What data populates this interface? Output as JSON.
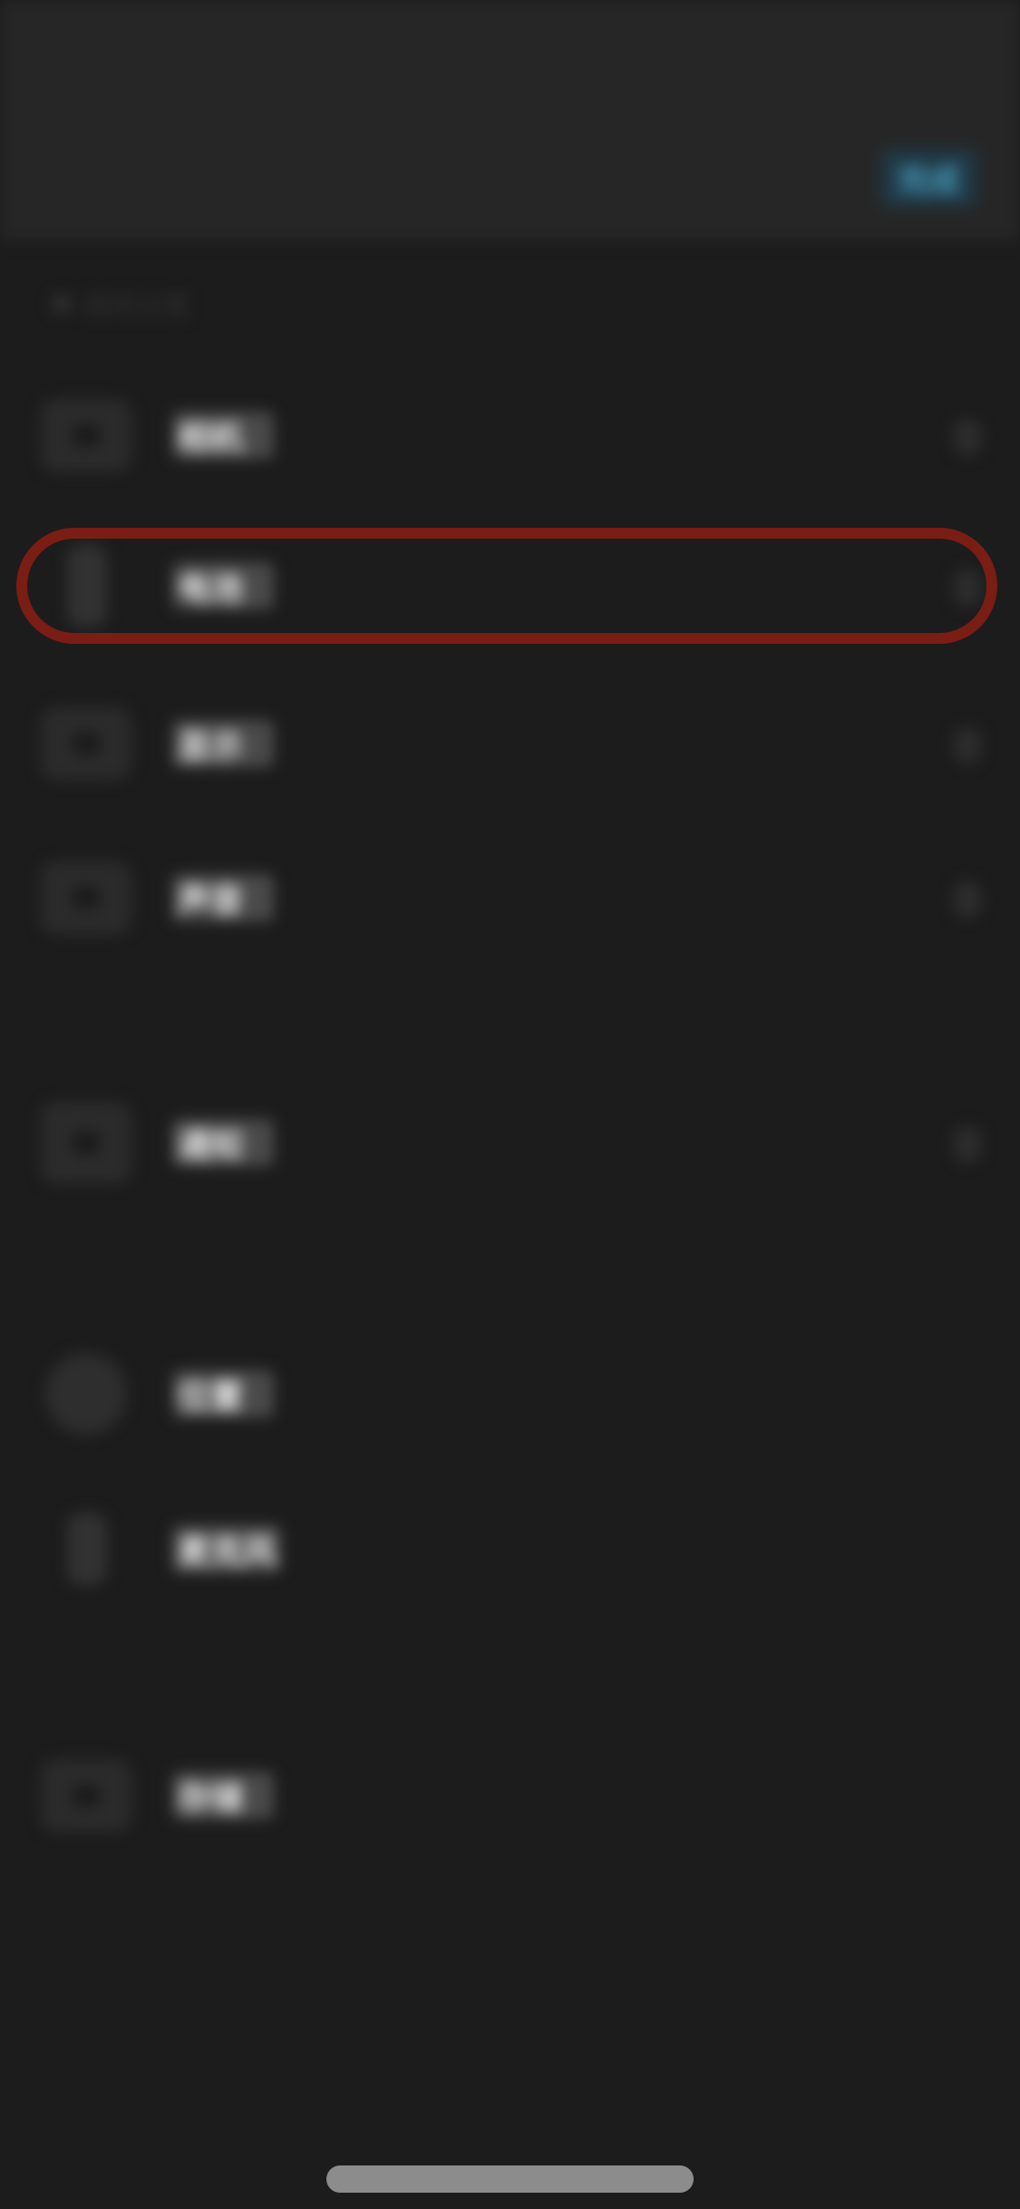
{
  "app": {
    "top_action_label": "完成",
    "section_header": "通用设置"
  },
  "rows": [
    {
      "name": "相机",
      "icon": "camera-icon",
      "chevron": true
    },
    {
      "name": "电池",
      "icon": "battery-icon",
      "chevron": true,
      "highlighted": true
    },
    {
      "name": "显示",
      "icon": "display-icon",
      "chevron": true
    },
    {
      "name": "声音",
      "icon": "speaker-icon",
      "chevron": true
    },
    {
      "name": "通知",
      "icon": "bell-icon",
      "chevron": true
    },
    {
      "name": "位置",
      "icon": "location-icon",
      "chevron": false
    },
    {
      "name": "麦克风",
      "icon": "microphone-icon",
      "chevron": false
    },
    {
      "name": "存储",
      "icon": "storage-icon",
      "chevron": false
    }
  ],
  "colors": {
    "background": "#1c1c1c",
    "top_bar": "#262626",
    "accent": "#4a9cbf",
    "highlight_ring": "#7a1d14"
  }
}
